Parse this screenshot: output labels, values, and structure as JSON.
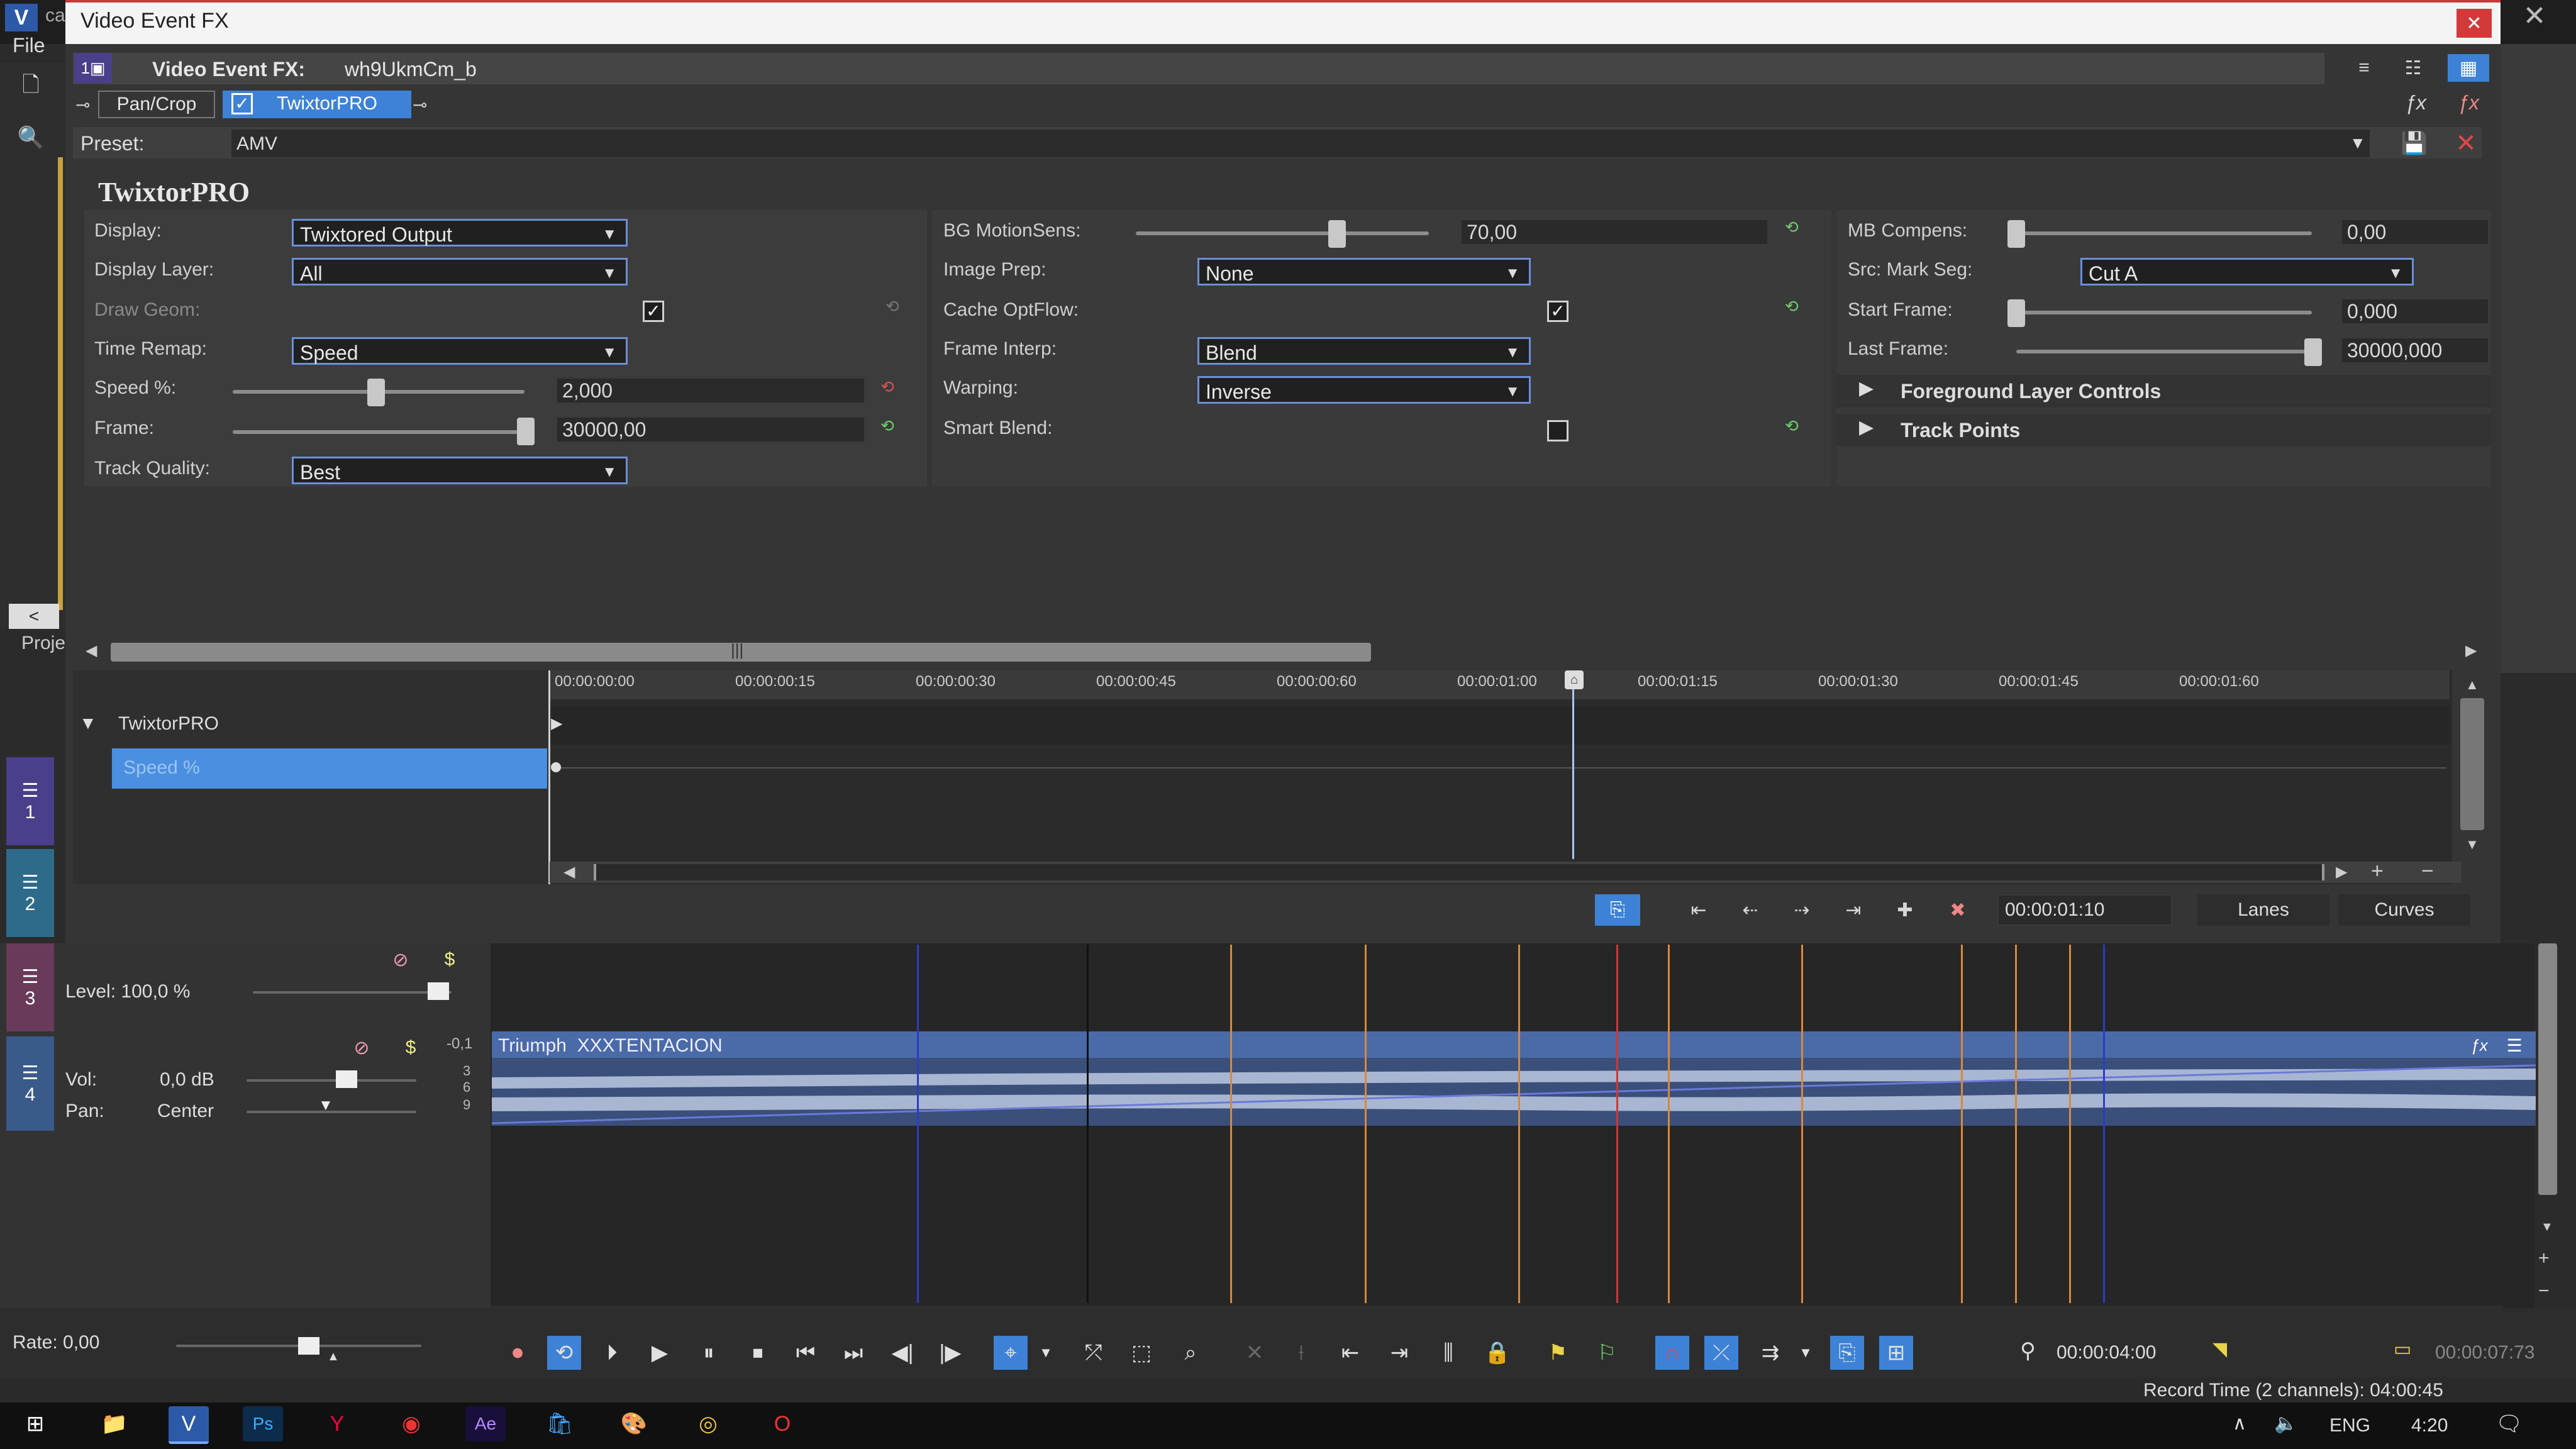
{
  "app": {
    "logo": "V",
    "window_title_fragment": "ca",
    "menu_file": "File",
    "project_tab": "Proje"
  },
  "dialog": {
    "title": "Video Event FX",
    "fx_header_label": "Video Event FX:",
    "fx_header_value": "wh9UkmCm_b",
    "chain": [
      "Pan/Crop",
      "TwixtorPRO"
    ],
    "preset_label": "Preset:",
    "preset_value": "AMV",
    "plugin_title": "TwixtorPRO"
  },
  "params_col1": {
    "display_label": "Display:",
    "display_value": "Twixtored Output",
    "layer_label": "Display Layer:",
    "layer_value": "All",
    "drawgeom_label": "Draw Geom:",
    "timeremap_label": "Time Remap:",
    "timeremap_value": "Speed",
    "speed_label": "Speed %:",
    "speed_value": "2,000",
    "frame_label": "Frame:",
    "frame_value": "30000,00",
    "quality_label": "Track Quality:",
    "quality_value": "Best"
  },
  "params_col2": {
    "bg_label": "BG MotionSens:",
    "bg_value": "70,00",
    "imageprep_label": "Image Prep:",
    "imageprep_value": "None",
    "cache_label": "Cache OptFlow:",
    "interp_label": "Frame Interp:",
    "interp_value": "Blend",
    "warp_label": "Warping:",
    "warp_value": "Inverse",
    "smart_label": "Smart Blend:"
  },
  "params_col3": {
    "mb_label": "MB Compens:",
    "mb_value": "0,00",
    "srcmark_label": "Src: Mark Seg:",
    "srcmark_value": "Cut A",
    "start_label": "Start Frame:",
    "start_value": "0,000",
    "last_label": "Last Frame:",
    "last_value": "30000,000",
    "fg_label": "Foreground Layer Controls",
    "tp_label": "Track Points"
  },
  "keyframes": {
    "ruler": [
      "00:00:00:00",
      "00:00:00:15",
      "00:00:00:30",
      "00:00:00:45",
      "00:00:00:60",
      "00:00:01:00",
      "00:00:01:15",
      "00:00:01:30",
      "00:00:01:45",
      "00:00:01:60"
    ],
    "tree_root": "TwixtorPRO",
    "tree_child": "Speed %",
    "time_value": "00:00:01:10",
    "lanes_label": "Lanes",
    "curves_label": "Curves"
  },
  "tracks": {
    "t1_num": "1",
    "t2_num": "2",
    "t3_num": "3",
    "t4_num": "4",
    "level_label": "Level: 100,0 %",
    "vol_label": "Vol:",
    "vol_value": "0,0 dB",
    "pan_label": "Pan:",
    "pan_value": "Center",
    "meter_top": "-0,1",
    "meter_ticks": [
      "3",
      "6",
      "9"
    ],
    "audio_clip_title": "Triumph  XXXTENTACION"
  },
  "transport": {
    "rate_label": "Rate: 0,00",
    "cursor_time": "00:00:04:00",
    "end_time": "00:00:07:73"
  },
  "status": {
    "record_time": "Record Time (2 channels): 04:00:45"
  },
  "taskbar": {
    "apps": [
      "Ps",
      "Ae"
    ],
    "vegas_label": "V",
    "lang": "ENG",
    "clock": "4:20"
  },
  "colors": {
    "accent_blue": "#3d82d6",
    "selection_blue": "#4a8fe0",
    "marker_orange": "#d8893a",
    "marker_red": "#c83a3a",
    "marker_blue": "#2a3cc8",
    "close_red": "#d23a3a",
    "track_purple": "#6a4fb0",
    "track_teal": "#2e6b8a"
  }
}
